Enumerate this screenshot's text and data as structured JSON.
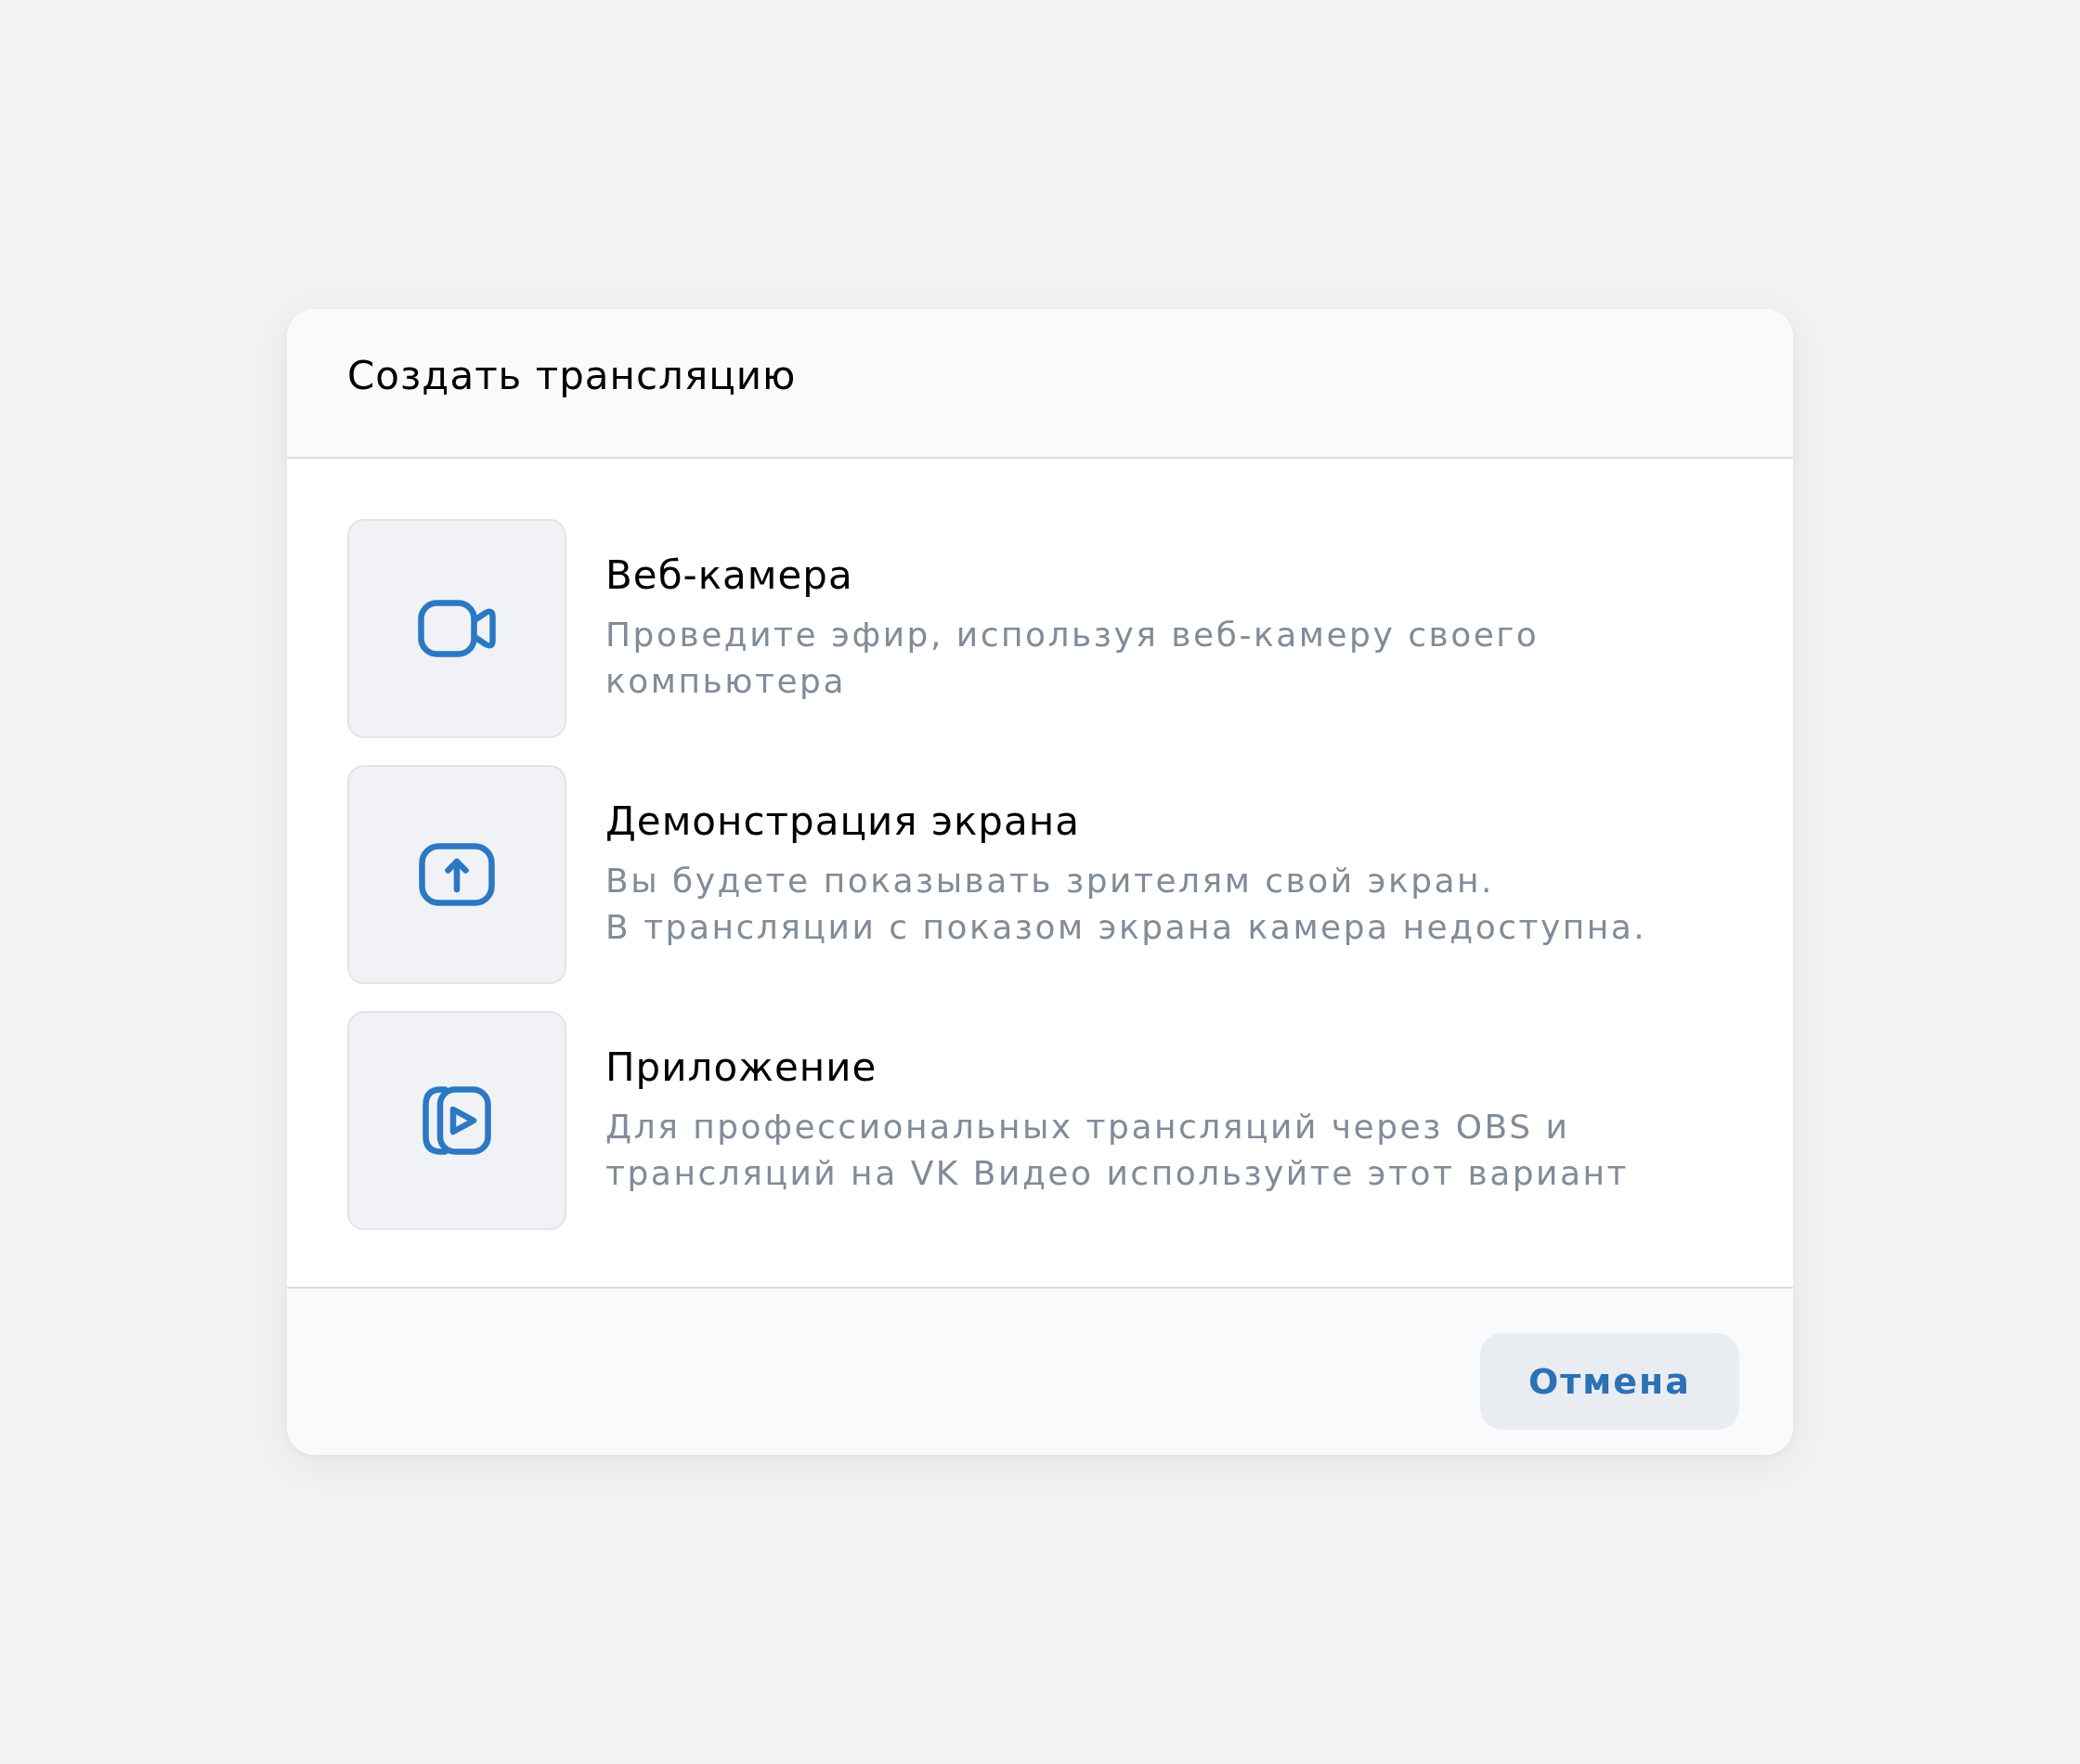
{
  "dialog": {
    "title": "Создать трансляцию",
    "options": [
      {
        "kind": "camera",
        "title": "Веб-камера",
        "description": "Проведите эфир, используя веб-камеру своего компьютера"
      },
      {
        "kind": "screen",
        "title": "Демонстрация экрана",
        "description": "Вы будете показывать зрителям свой экран.\nВ трансляции с показом экрана камера недоступна."
      },
      {
        "kind": "app",
        "title": "Приложение",
        "description": "Для профессиональных трансляций через OBS и трансляций на VK Видео используйте этот вариант"
      }
    ],
    "buttons": [
      "Отмена"
    ]
  }
}
